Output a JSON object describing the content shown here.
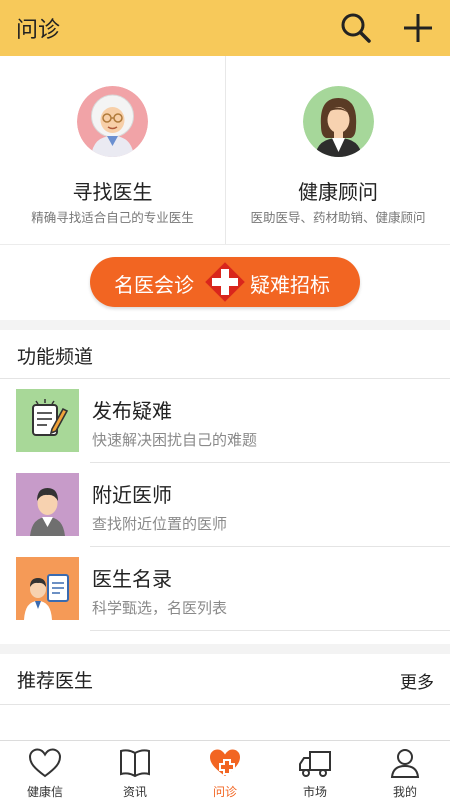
{
  "header": {
    "title": "问诊",
    "icons": [
      "search-icon",
      "plus-icon"
    ]
  },
  "top_cards": [
    {
      "title": "寻找医生",
      "subtitle": "精确寻找适合自己的专业医生"
    },
    {
      "title": "健康顾问",
      "subtitle": "医助医导、药材助销、健康顾问"
    }
  ],
  "banner": {
    "left_text": "名医会诊",
    "right_text": "疑难招标"
  },
  "channel": {
    "title": "功能频道",
    "items": [
      {
        "title": "发布疑难",
        "subtitle": "快速解决困扰自己的难题"
      },
      {
        "title": "附近医师",
        "subtitle": "查找附近位置的医师"
      },
      {
        "title": "医生名录",
        "subtitle": "科学甄选，名医列表"
      }
    ]
  },
  "recommend": {
    "title": "推荐医生",
    "more": "更多"
  },
  "tabbar": {
    "items": [
      {
        "label": "健康信",
        "icon": "heart-icon"
      },
      {
        "label": "资讯",
        "icon": "book-icon"
      },
      {
        "label": "问诊",
        "icon": "heart-plus-icon"
      },
      {
        "label": "市场",
        "icon": "truck-icon"
      },
      {
        "label": "我的",
        "icon": "person-icon"
      }
    ],
    "active_index": 2
  },
  "colors": {
    "header": "#f7c95a",
    "accent": "#f26522"
  }
}
